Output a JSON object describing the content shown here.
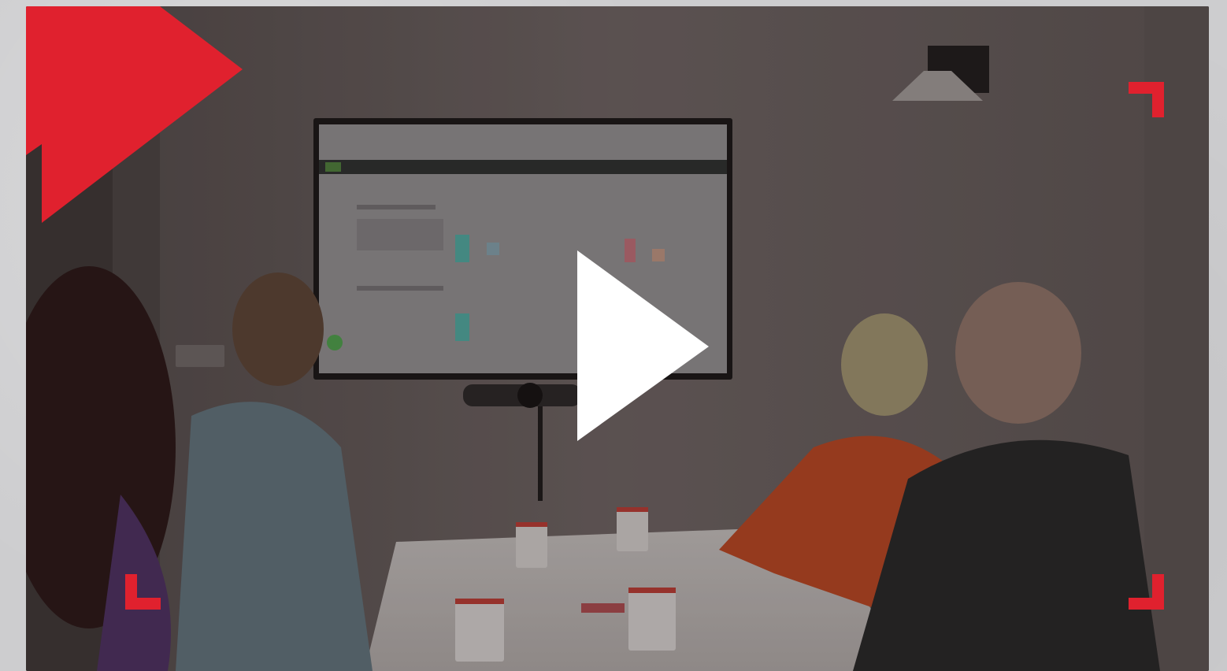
{
  "player": {
    "play_icon": "play-icon",
    "brand_icon": "brand-chevron-icon",
    "corner_icon": "corner-bracket-icon"
  },
  "colors": {
    "brand_red": "#e0212e",
    "play_white": "#ffffff",
    "page_background": "#cdcdcf"
  }
}
